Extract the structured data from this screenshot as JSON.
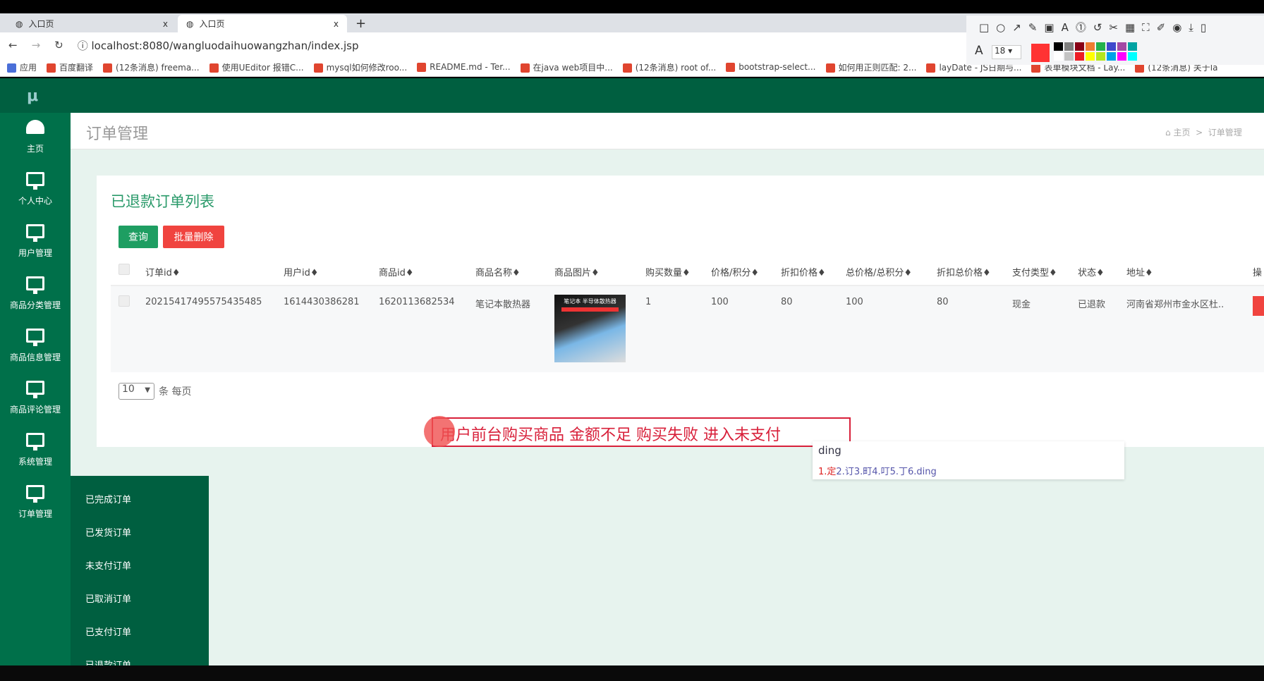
{
  "browser": {
    "tabs": [
      {
        "title": "入口页",
        "close": "x"
      },
      {
        "title": "入口页",
        "close": "x"
      }
    ],
    "new_tab": "+",
    "url": "localhost:8080/wangluodaihuowangzhan/index.jsp",
    "bookmarks": [
      "应用",
      "百度翻译",
      "(12条消息) freema...",
      "使用UEditor 报错C...",
      "mysql如何修改roo...",
      "README.md - Ter...",
      "在java web项目中...",
      "(12条消息) root of...",
      "bootstrap-select...",
      "如何用正则匹配: 2...",
      "layDate - JS日期与...",
      "表单模块文档 - Lay...",
      "(12条消息) 关于la"
    ],
    "snip_toolbar": {
      "font_size": "18",
      "font_label": "A",
      "colors": [
        "#000000",
        "#7f7f7f",
        "#880015",
        "#ed7d31",
        "#22b14c",
        "#3f48cc",
        "#a349a4",
        "#00a2a2",
        "#ffffff",
        "#c3c3c3",
        "#ed1c24",
        "#ffff00",
        "#b5e61d",
        "#00a2e8",
        "#ff00ff",
        "#00ffff"
      ],
      "active_color": "#ff3333"
    }
  },
  "app": {
    "logo": "μ",
    "sidebar": [
      {
        "label": "主页",
        "icon": "dashboard-icon"
      },
      {
        "label": "个人中心",
        "icon": "monitor-icon"
      },
      {
        "label": "用户管理",
        "icon": "monitor-icon"
      },
      {
        "label": "商品分类管理",
        "icon": "monitor-icon"
      },
      {
        "label": "商品信息管理",
        "icon": "monitor-icon"
      },
      {
        "label": "商品评论管理",
        "icon": "monitor-icon"
      },
      {
        "label": "系统管理",
        "icon": "monitor-icon"
      },
      {
        "label": "订单管理",
        "icon": "monitor-icon"
      }
    ],
    "submenu": [
      "已完成订单",
      "已发货订单",
      "未支付订单",
      "已取消订单",
      "已支付订单",
      "已退款订单"
    ],
    "page_title": "订单管理",
    "breadcrumb": {
      "home": "主页",
      "sep": ">",
      "current": "订单管理"
    },
    "card_title": "已退款订单列表",
    "query_btn": "查询",
    "batch_delete_btn": "批量删除",
    "columns": [
      "订单id♦",
      "用户id♦",
      "商品id♦",
      "商品名称♦",
      "商品图片♦",
      "购买数量♦",
      "价格/积分♦",
      "折扣价格♦",
      "总价格/总积分♦",
      "折扣总价格♦",
      "支付类型♦",
      "状态♦",
      "地址♦",
      "操"
    ],
    "row": {
      "order_id": "20215417495575435485",
      "user_id": "1614430386281",
      "product_id": "1620113682534",
      "product_name": "笔记本散热器",
      "image_caption": "笔记本 半导体散热器",
      "quantity": "1",
      "price": "100",
      "discount_price": "80",
      "total": "100",
      "discount_total": "80",
      "pay_type": "现金",
      "status": "已退款",
      "address": "河南省郑州市金水区杜.."
    },
    "page_size": "10",
    "page_size_label": "条 每页",
    "colors": {
      "header": "#005f40",
      "sidebar": "#00704a",
      "accent": "#1e9e62",
      "danger": "#f0443f"
    }
  },
  "annotation": {
    "text": "用户前台购买商品 金额不足 购买失败 进入未支付",
    "color": "#d8203a"
  },
  "ime": {
    "composition": "ding",
    "candidates": [
      "1.定",
      "2.订",
      "3.町",
      "4.叮",
      "5.丁",
      "6.ding"
    ]
  }
}
